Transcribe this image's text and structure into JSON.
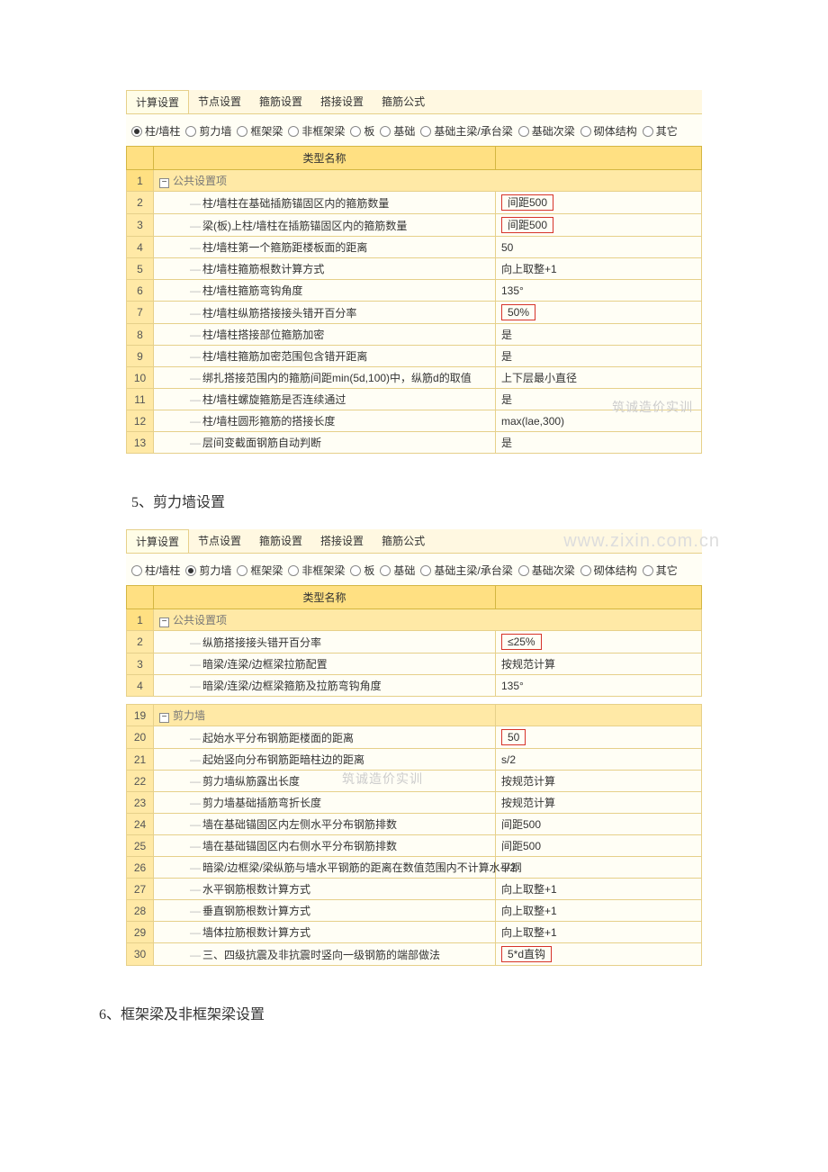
{
  "tabs": [
    "计算设置",
    "节点设置",
    "箍筋设置",
    "搭接设置",
    "箍筋公式"
  ],
  "radios": [
    "柱/墙柱",
    "剪力墙",
    "框架梁",
    "非框架梁",
    "板",
    "基础",
    "基础主梁/承台梁",
    "基础次梁",
    "砌体结构",
    "其它"
  ],
  "header_name": "类型名称",
  "header_value": "",
  "panel1": {
    "activeTab": 0,
    "activeRadio": 0,
    "group_label": "公共设置项",
    "rows": [
      {
        "n": "2",
        "label": "柱/墙柱在基础插筋锚固区内的箍筋数量",
        "val": "间距500",
        "hl": true
      },
      {
        "n": "3",
        "label": "梁(板)上柱/墙柱在插筋锚固区内的箍筋数量",
        "val": "间距500",
        "hl": true
      },
      {
        "n": "4",
        "label": "柱/墙柱第一个箍筋距楼板面的距离",
        "val": "50"
      },
      {
        "n": "5",
        "label": "柱/墙柱箍筋根数计算方式",
        "val": "向上取整+1"
      },
      {
        "n": "6",
        "label": "柱/墙柱箍筋弯钩角度",
        "val": "135°"
      },
      {
        "n": "7",
        "label": "柱/墙柱纵筋搭接接头错开百分率",
        "val": "50%",
        "hl": true
      },
      {
        "n": "8",
        "label": "柱/墙柱搭接部位箍筋加密",
        "val": "是"
      },
      {
        "n": "9",
        "label": "柱/墙柱箍筋加密范围包含错开距离",
        "val": "是"
      },
      {
        "n": "10",
        "label": "绑扎搭接范围内的箍筋间距min(5d,100)中，纵筋d的取值",
        "val": "上下层最小直径"
      },
      {
        "n": "11",
        "label": "柱/墙柱螺旋箍筋是否连续通过",
        "val": "是"
      },
      {
        "n": "12",
        "label": "柱/墙柱圆形箍筋的搭接长度",
        "val": "max(lae,300)"
      },
      {
        "n": "13",
        "label": "层间变截面钢筋自动判断",
        "val": "是"
      }
    ],
    "watermark": "筑诚造价实训"
  },
  "caption1": "5、剪力墙设置",
  "panel2": {
    "activeTab": 0,
    "activeRadio": 1,
    "group_label": "公共设置项",
    "group2_label": "剪力墙",
    "rows1": [
      {
        "n": "2",
        "label": "纵筋搭接接头错开百分率",
        "val": "≤25%",
        "hl": true
      },
      {
        "n": "3",
        "label": "暗梁/连梁/边框梁拉筋配置",
        "val": "按规范计算"
      },
      {
        "n": "4",
        "label": "暗梁/连梁/边框梁箍筋及拉筋弯钩角度",
        "val": "135°"
      }
    ],
    "rows2": [
      {
        "n": "20",
        "label": "起始水平分布钢筋距楼面的距离",
        "val": "50",
        "hl": true
      },
      {
        "n": "21",
        "label": "起始竖向分布钢筋距暗柱边的距离",
        "val": "s/2"
      },
      {
        "n": "22",
        "label": "剪力墙纵筋露出长度",
        "val": "按规范计算"
      },
      {
        "n": "23",
        "label": "剪力墙基础插筋弯折长度",
        "val": "按规范计算"
      },
      {
        "n": "24",
        "label": "墙在基础锚固区内左侧水平分布钢筋排数",
        "val": "间距500"
      },
      {
        "n": "25",
        "label": "墙在基础锚固区内右侧水平分布钢筋排数",
        "val": "间距500"
      },
      {
        "n": "26",
        "label": "暗梁/边框梁/梁纵筋与墙水平钢筋的距离在数值范围内不计算水平钢",
        "val": "s/2"
      },
      {
        "n": "27",
        "label": "水平钢筋根数计算方式",
        "val": "向上取整+1"
      },
      {
        "n": "28",
        "label": "垂直钢筋根数计算方式",
        "val": "向上取整+1"
      },
      {
        "n": "29",
        "label": "墙体拉筋根数计算方式",
        "val": "向上取整+1"
      },
      {
        "n": "30",
        "label": "三、四级抗震及非抗震时竖向一级钢筋的端部做法",
        "val": "5*d直钩",
        "hl": true
      }
    ],
    "url_watermark": "www.zixin.com.cn",
    "watermark": "筑诚造价实训"
  },
  "caption2": "6、框架梁及非框架梁设置"
}
